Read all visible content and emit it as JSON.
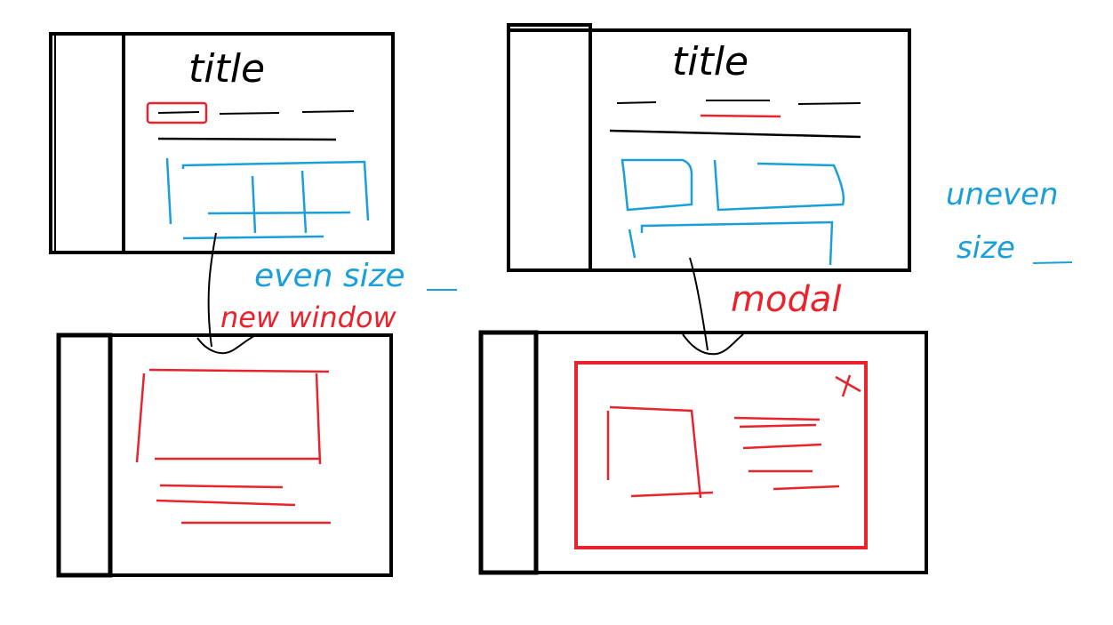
{
  "colors": {
    "ink": "#000000",
    "red": "#e8232b",
    "blue": "#1aa0d8",
    "background": "#ffffff"
  },
  "labels": {
    "title_left": "title",
    "title_right": "title",
    "even_size": "even size",
    "uneven_size_line1": "uneven",
    "uneven_size_line2": "size",
    "new_window": "new window",
    "modal": "modal"
  },
  "icons": {
    "modal_close": "close-icon"
  }
}
